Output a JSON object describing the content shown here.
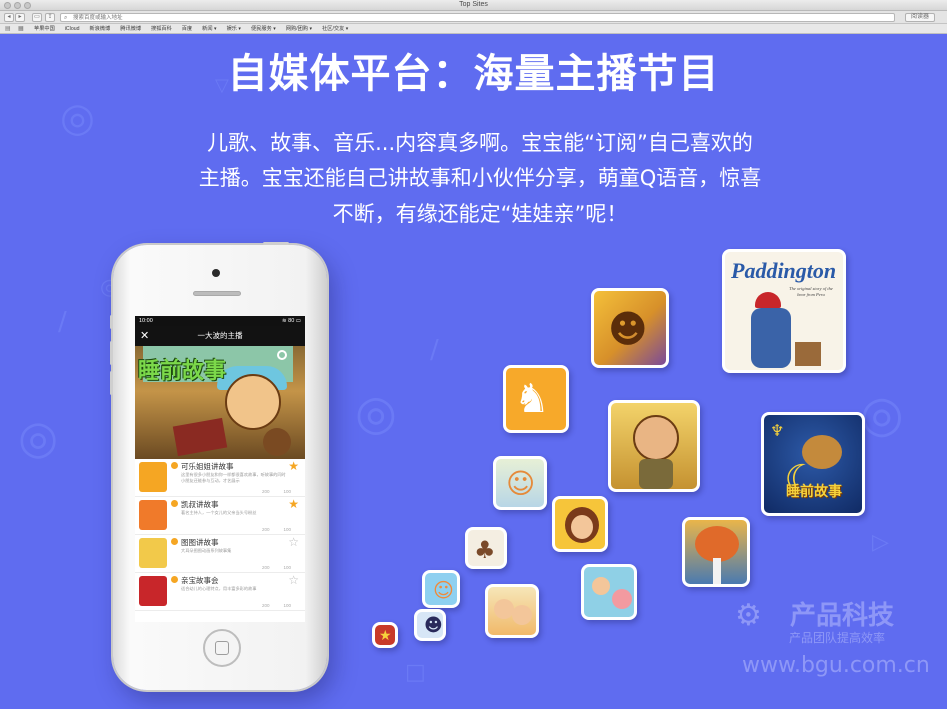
{
  "browser": {
    "window_title": "Top Sites",
    "address_placeholder": "搜索百度或输入地址",
    "reader_label": "阅读器",
    "bookmarks": [
      "苹果中国",
      "iCloud",
      "新浪微博",
      "腾讯微博",
      "搜狐百科",
      "百度",
      "新闻 ▾",
      "娱乐 ▾",
      "便民服务 ▾",
      "网购/团购 ▾",
      "社区/交友 ▾"
    ]
  },
  "page": {
    "headline": "自媒体平台：海量主播节目",
    "subtitle_lines": [
      "儿歌、故事、音乐...内容真多啊。宝宝能“订阅”自己喜欢的",
      "主播。宝宝还能自己讲故事和小伙伴分享，萌童Q语音，惊喜",
      "不断，有缘还能定“娃娃亲”呢！"
    ]
  },
  "phone_screen": {
    "status_time": "10:00",
    "status_battery": "80",
    "nav_title": "一大波的主播",
    "banner_title": "睡前故事",
    "items": [
      {
        "title": "可乐姐姐讲故事",
        "desc": "这里有很多小朋友和你一样都很喜欢故事，听故事的同时小朋友还能参与互动，才艺展示",
        "likes": "200",
        "thumbs": "100",
        "starred": true
      },
      {
        "title": "凯叔讲故事",
        "desc": "著名主持人，一个女儿的父亲当头号粉丝",
        "likes": "200",
        "thumbs": "100",
        "starred": true
      },
      {
        "title": "图图讲故事",
        "desc": "大耳朵图图动画系列故事集",
        "likes": "200",
        "thumbs": "100",
        "starred": false
      },
      {
        "title": "亲宝故事会",
        "desc": "适合幼儿的心理特点，用丰富多彩的故事",
        "likes": "200",
        "thumbs": "100",
        "starred": false
      }
    ]
  },
  "tiles": {
    "paddington_title": "Paddington",
    "paddington_sub": "The original story of the bear from Peru",
    "sleep_story": "睡前故事"
  },
  "watermark": {
    "brand": "产品科技",
    "tagline": "产品团队提高效率",
    "url": "www.bgu.com.cn"
  },
  "colors": {
    "background": "#5f6cf0",
    "star_active": "#f5a623"
  }
}
